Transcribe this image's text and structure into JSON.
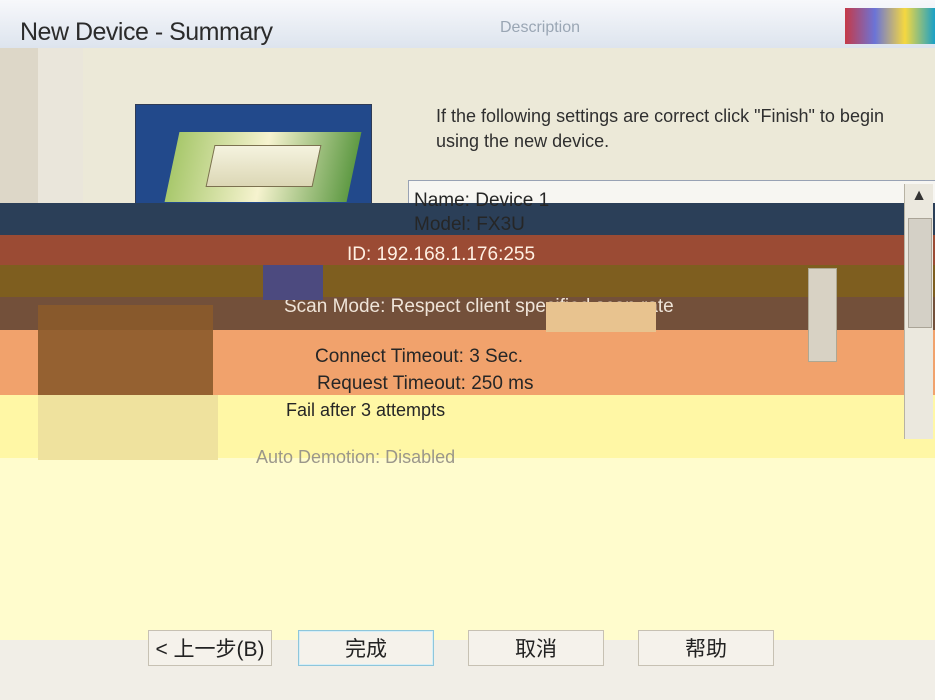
{
  "window": {
    "title": "New Device - Summary",
    "title_ghost": "Description"
  },
  "intro": {
    "line1": "If the following settings are correct click \"Finish\" to begin",
    "line2": "using the new device."
  },
  "summary": {
    "name": "Name: Device 1",
    "model": "Model: FX3U",
    "id": "ID: 192.168.1.176:255",
    "scan_mode": "Scan Mode: Respect client specified scan rate",
    "connect_timeout": "Connect Timeout: 3 Sec.",
    "request_timeout": "Request Timeout: 250 ms",
    "fail_after": "Fail after 3 attempts",
    "auto_demotion": "Auto Demotion: Disabled"
  },
  "buttons": {
    "back": "< 上一步(B)",
    "finish": "完成",
    "cancel": "取消",
    "help": "帮助"
  },
  "icons": {
    "scroll_up": "▲"
  },
  "colors": {
    "window_bg": "#ece9d8",
    "selection": "#2b3f58",
    "accent": "#f1a26c"
  }
}
